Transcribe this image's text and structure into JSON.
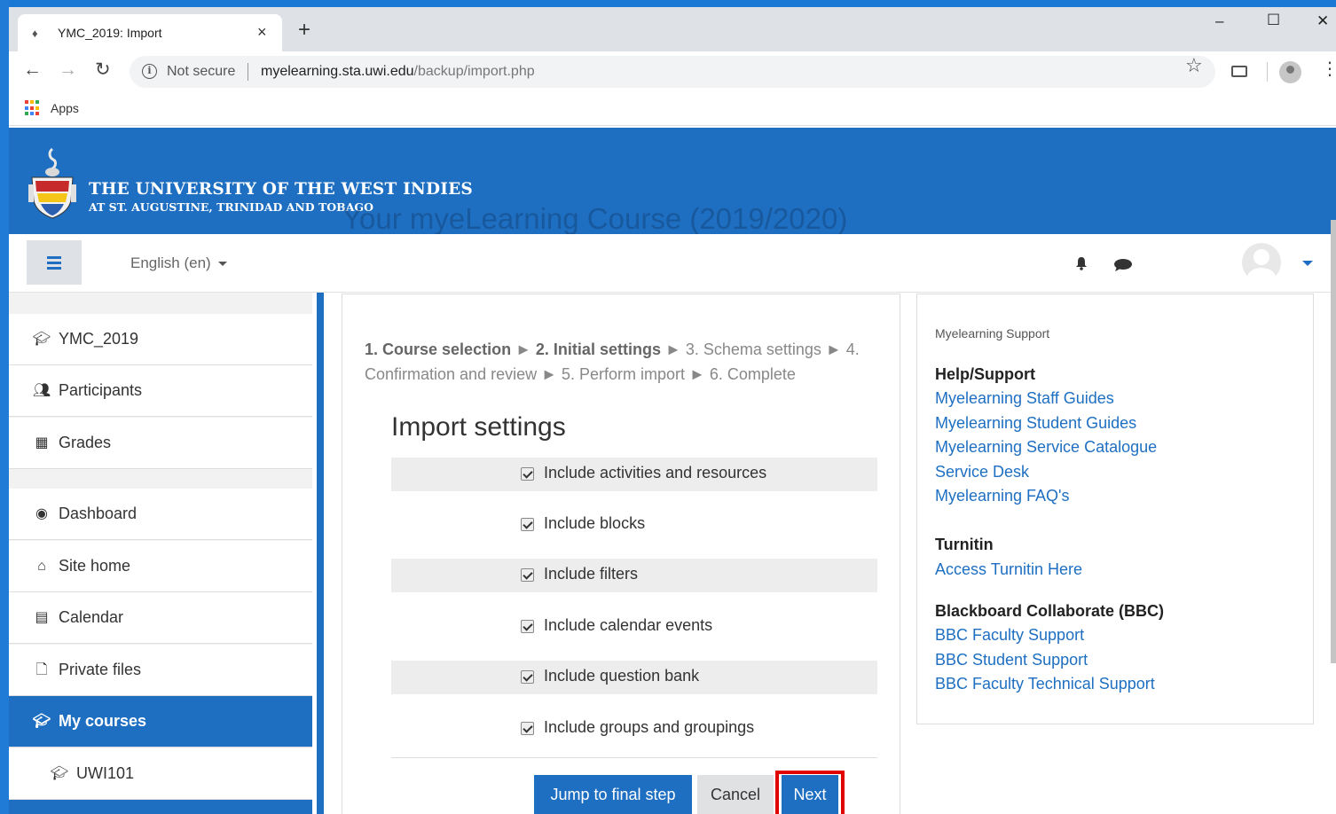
{
  "browser": {
    "tab_title": "YMC_2019: Import",
    "close_tab": "×",
    "new_tab": "+",
    "win_minimize": "–",
    "win_maximize": "☐",
    "win_close": "✕",
    "security": "Not secure",
    "url_host": "myelearning.sta.uwi.edu",
    "url_path": "/backup/import.php",
    "bookmarks_apps": "Apps",
    "icons": [
      "back-arrow-icon",
      "forward-arrow-icon",
      "reload-icon",
      "info-icon",
      "star-icon",
      "cast-icon",
      "profile-icon",
      "menu-dots-icon"
    ]
  },
  "banner": {
    "university": "THE UNIVERSITY OF THE WEST INDIES",
    "campus": "AT ST. AUGUSTINE, TRINIDAD AND TOBAGO",
    "course_title": "Your myeLearning Course (2019/2020)"
  },
  "navbar": {
    "language": "English (en)"
  },
  "sidebar": {
    "items": [
      {
        "label": "YMC_2019",
        "icon": "graduation-cap-icon"
      },
      {
        "label": "Participants",
        "icon": "users-icon"
      },
      {
        "label": "Grades",
        "icon": "table-icon"
      },
      {
        "label": "Dashboard",
        "icon": "dashboard-icon"
      },
      {
        "label": "Site home",
        "icon": "home-icon"
      },
      {
        "label": "Calendar",
        "icon": "calendar-icon"
      },
      {
        "label": "Private files",
        "icon": "file-icon"
      },
      {
        "label": "My courses",
        "icon": "graduation-cap-icon"
      },
      {
        "label": "UWI101",
        "icon": "graduation-cap-icon"
      }
    ]
  },
  "main": {
    "steps": {
      "s1": "1. Course selection",
      "s2": "2. Initial settings",
      "s3": "3. Schema settings",
      "s4": "4. Confirmation and review",
      "s5": "5. Perform import",
      "s6": "6. Complete",
      "arrow": "►"
    },
    "heading": "Import settings",
    "options": [
      {
        "label": "Include activities and resources",
        "checked": true
      },
      {
        "label": "Include blocks",
        "checked": true
      },
      {
        "label": "Include filters",
        "checked": true
      },
      {
        "label": "Include calendar events",
        "checked": true
      },
      {
        "label": "Include question bank",
        "checked": true
      },
      {
        "label": "Include groups and groupings",
        "checked": true
      }
    ],
    "buttons": {
      "final": "Jump to final step",
      "cancel": "Cancel",
      "next": "Next"
    }
  },
  "support": {
    "block_title": "Myelearning Support",
    "help_heading": "Help/Support",
    "help_links": [
      "Myelearning Staff Guides",
      "Myelearning Student Guides",
      "Myelearning Service Catalogue",
      "Service Desk",
      "Myelearning FAQ's"
    ],
    "turnitin_heading": "Turnitin",
    "turnitin_link": "Access Turnitin Here",
    "bbc_heading": "Blackboard Collaborate (BBC)",
    "bbc_links": [
      "BBC Faculty Support",
      "BBC Student Support",
      "BBC Faculty Technical Support"
    ]
  },
  "colors": {
    "brand_blue": "#1e6fc2",
    "highlight_red": "#e00000"
  }
}
